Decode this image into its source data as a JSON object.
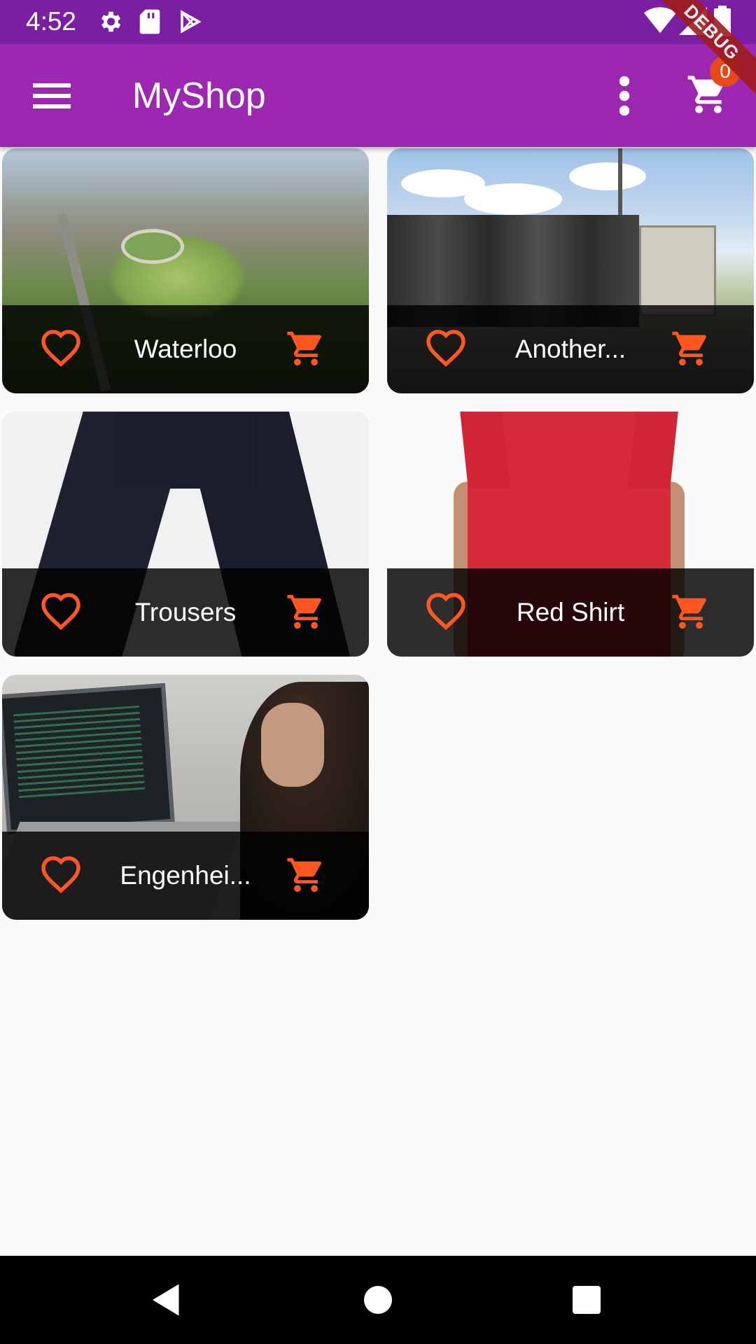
{
  "status_bar": {
    "time": "4:52",
    "left_icons": [
      "settings-icon",
      "sd-card-icon",
      "play-store-icon"
    ],
    "right_icons": [
      "wifi-icon",
      "signal-icon",
      "battery-icon"
    ]
  },
  "app_bar": {
    "title": "MyShop",
    "menu_icon": "menu-icon",
    "more_icon": "more-vert-icon",
    "cart_icon": "shopping-cart-icon",
    "cart_count": "0",
    "debug_banner": "DEBUG"
  },
  "products": [
    {
      "title": "Waterloo",
      "image": "city-aerial"
    },
    {
      "title": "Another...",
      "image": "truck"
    },
    {
      "title": "Trousers",
      "image": "trousers"
    },
    {
      "title": "Red Shirt",
      "image": "red-shirt"
    },
    {
      "title": "Engenhei...",
      "image": "person-laptop"
    }
  ],
  "colors": {
    "status_bar": "#7b1fa2",
    "primary": "#9c27b0",
    "accent": "#ff5722",
    "tile_footer": "#000000",
    "background": "#fafafa"
  },
  "nav_bar": {
    "buttons": [
      "back-icon",
      "home-icon",
      "recents-icon"
    ]
  }
}
